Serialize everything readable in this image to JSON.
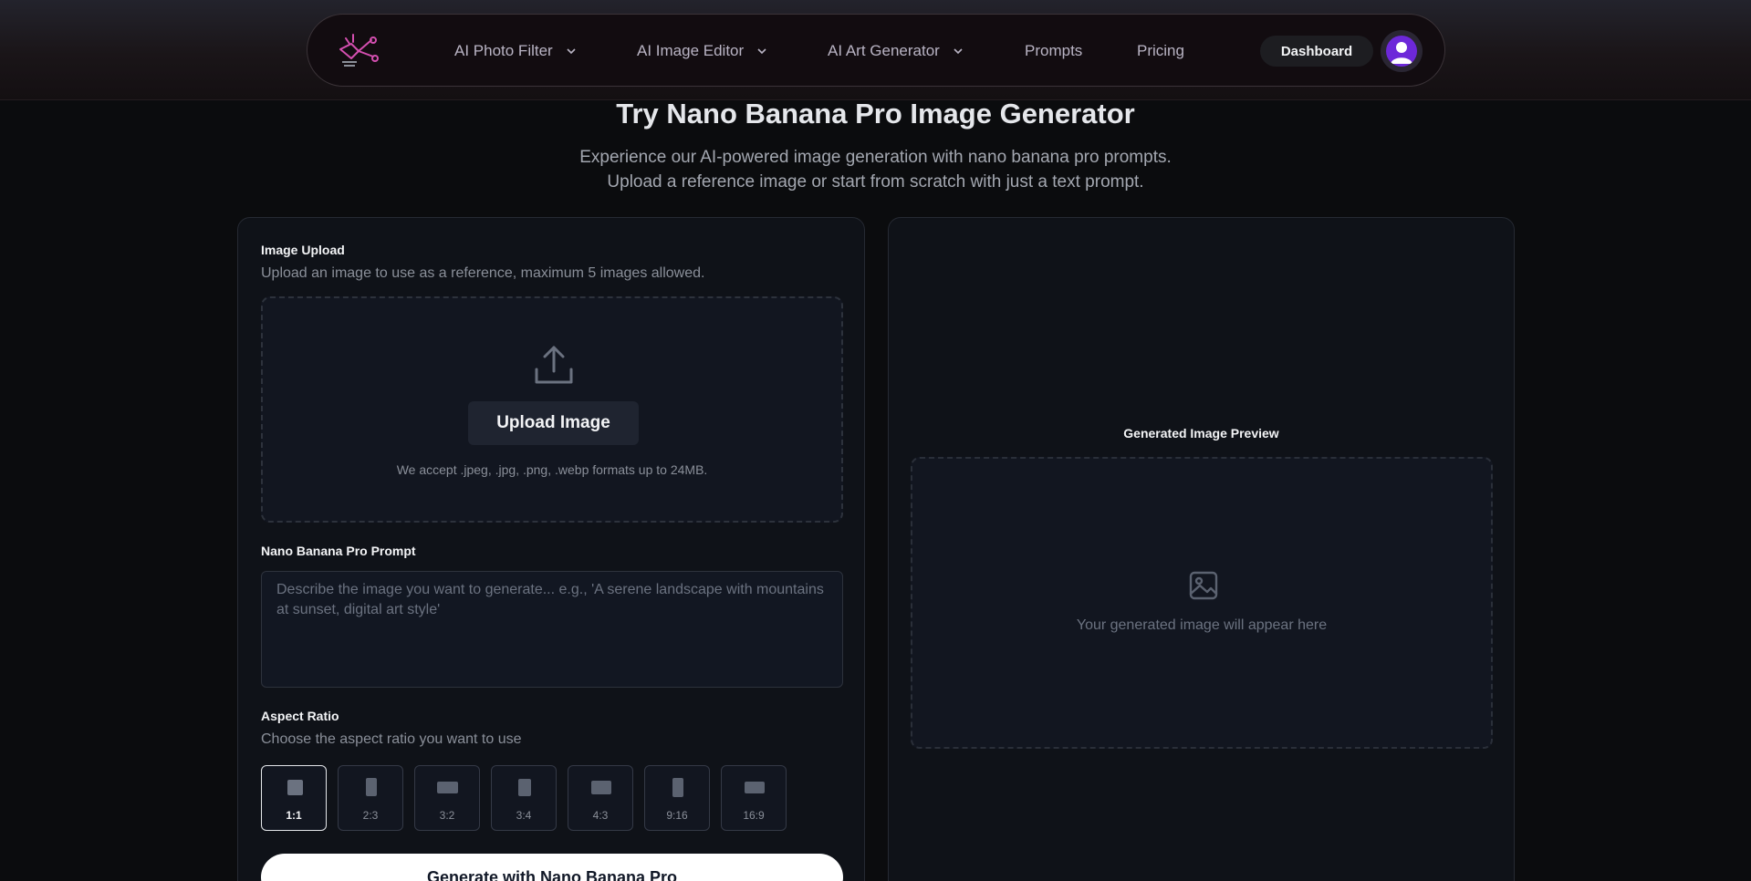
{
  "nav": {
    "items": [
      {
        "label": "AI Photo Filter",
        "has_dropdown": true
      },
      {
        "label": "AI Image Editor",
        "has_dropdown": true
      },
      {
        "label": "AI Art Generator",
        "has_dropdown": true
      },
      {
        "label": "Prompts",
        "has_dropdown": false
      },
      {
        "label": "Pricing",
        "has_dropdown": false
      }
    ],
    "dashboard_label": "Dashboard",
    "logo_icon": "scissors-bird-logo-icon",
    "avatar_icon": "user-avatar-icon"
  },
  "hero": {
    "title": "Try Nano Banana Pro Image Generator",
    "subtitle_line1": "Experience our AI-powered image generation with nano banana pro prompts.",
    "subtitle_line2": "Upload a reference image or start from scratch with just a text prompt."
  },
  "upload": {
    "label": "Image Upload",
    "hint": "Upload an image to use as a reference, maximum 5 images allowed.",
    "button_label": "Upload Image",
    "formats": "We accept .jpeg, .jpg, .png, .webp formats up to 24MB.",
    "icon": "upload-icon"
  },
  "prompt": {
    "label": "Nano Banana Pro Prompt",
    "value": "",
    "placeholder": "Describe the image you want to generate... e.g., 'A serene landscape with mountains at sunset, digital art style'"
  },
  "aspect": {
    "label": "Aspect Ratio",
    "hint": "Choose the aspect ratio you want to use",
    "selected": "1:1",
    "options": [
      "1:1",
      "2:3",
      "3:2",
      "3:4",
      "4:3",
      "9:16",
      "16:9"
    ]
  },
  "generate": {
    "label": "Generate with Nano Banana Pro"
  },
  "preview": {
    "title": "Generated Image Preview",
    "placeholder_text": "Your generated image will appear here",
    "icon": "image-placeholder-icon"
  },
  "colors": {
    "background": "#0b0c0e",
    "card": "#0f1218",
    "avatar_accent": "#6d28d9",
    "logo_accent": "#d44fb0"
  }
}
